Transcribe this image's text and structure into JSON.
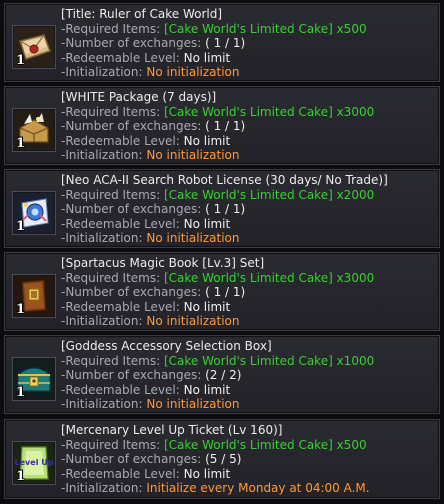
{
  "items": [
    {
      "title": "[Title: Ruler of Cake World]",
      "icon": "scroll-letter-icon",
      "quantity": "1",
      "required_label": "-Required Items:",
      "required_value": "[Cake World's Limited Cake] x500",
      "exchanges_label": "-Number of exchanges:",
      "exchanges_value": "( 1 / 1)",
      "level_label": "-Redeemable Level:",
      "level_value": "No limit",
      "init_label": "-Initialization:",
      "init_value": "No initialization"
    },
    {
      "title": "[WHITE Package (7 days)]",
      "icon": "treasure-chest-icon",
      "quantity": "1",
      "required_label": "-Required Items:",
      "required_value": "[Cake World's Limited Cake] x3000",
      "exchanges_label": "-Number of exchanges:",
      "exchanges_value": "( 1 / 1)",
      "level_label": "-Redeemable Level:",
      "level_value": "No limit",
      "init_label": "-Initialization:",
      "init_value": "No initialization"
    },
    {
      "title": "[Neo ACA-II Search Robot License (30 days/ No Trade)]",
      "icon": "robot-license-icon",
      "quantity": "1",
      "required_label": "-Required Items:",
      "required_value": "[Cake World's Limited Cake] x2000",
      "exchanges_label": "-Number of exchanges:",
      "exchanges_value": "( 1 / 1)",
      "level_label": "-Redeemable Level:",
      "level_value": "No limit",
      "init_label": "-Initialization:",
      "init_value": "No initialization"
    },
    {
      "title": "[Spartacus Magic Book [Lv.3] Set]",
      "icon": "magic-book-icon",
      "quantity": "1",
      "required_label": "-Required Items:",
      "required_value": "[Cake World's Limited Cake] x3000",
      "exchanges_label": "-Number of exchanges:",
      "exchanges_value": "( 1 / 1)",
      "level_label": "-Redeemable Level:",
      "level_value": "No limit",
      "init_label": "-Initialization:",
      "init_value": "No initialization"
    },
    {
      "title": "[Goddess Accessory Selection Box]",
      "icon": "accessory-box-icon",
      "quantity": "1",
      "required_label": "-Required Items:",
      "required_value": "[Cake World's Limited Cake] x1000",
      "exchanges_label": "-Number of exchanges:",
      "exchanges_value": "(2 / 2)",
      "level_label": "-Redeemable Level:",
      "level_value": "No limit",
      "init_label": "-Initialization:",
      "init_value": "No initialization"
    },
    {
      "title": "[Mercenary Level Up Ticket (Lv 160)]",
      "icon": "level-up-ticket-icon",
      "icon_text": "Level Up",
      "quantity": "1",
      "required_label": "-Required Items:",
      "required_value": "[Cake World's Limited Cake] x500",
      "exchanges_label": "-Number of exchanges:",
      "exchanges_value": "(5 / 5)",
      "level_label": "-Redeemable Level:",
      "level_value": "No limit",
      "init_label": "-Initialization:",
      "init_value": "Initialize every Monday at 04:00 A.M."
    }
  ],
  "colors": {
    "green": "#35d22e",
    "orange": "#ff9a3c",
    "label": "#a9a9b0"
  }
}
